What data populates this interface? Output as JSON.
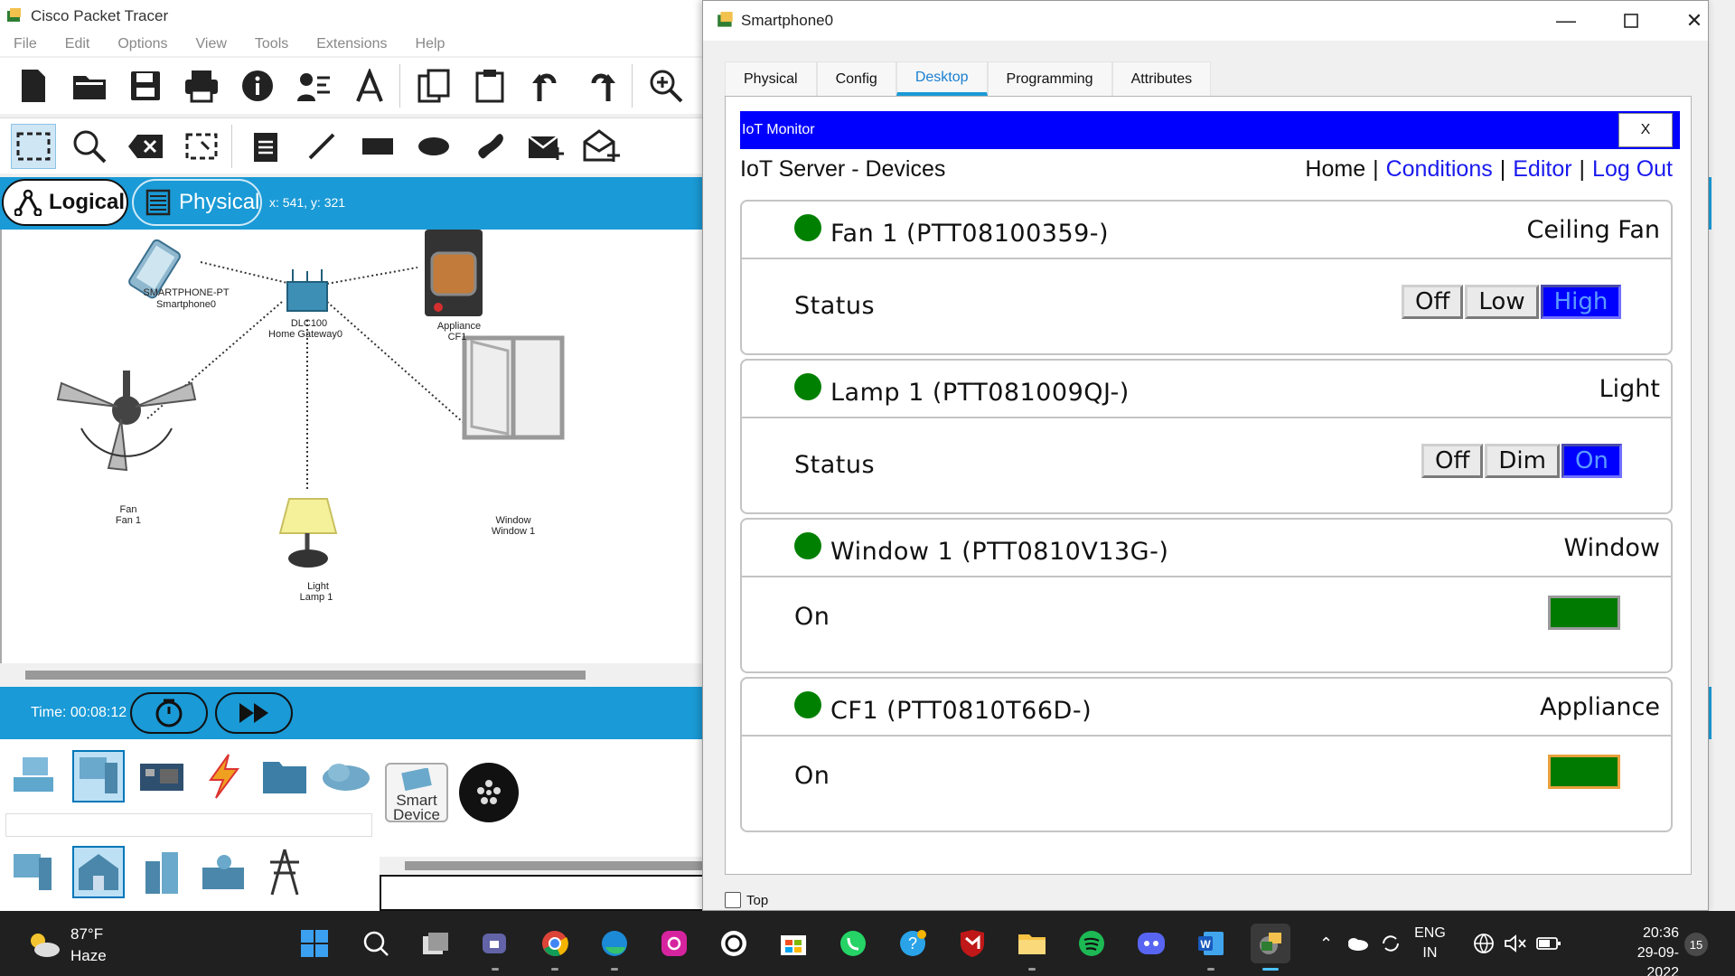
{
  "app": {
    "title": "Cisco Packet Tracer",
    "menu": [
      "File",
      "Edit",
      "Options",
      "View",
      "Tools",
      "Extensions",
      "Help"
    ]
  },
  "modes": {
    "logical": "Logical",
    "physical": "Physical",
    "coords": "x: 541, y: 321"
  },
  "workspace": {
    "devices": [
      {
        "model": "SMARTPHONE-PT",
        "name": "Smartphone0"
      },
      {
        "model": "DLC100",
        "name": "Home Gateway0"
      },
      {
        "model": "Appliance",
        "name": "CF1"
      },
      {
        "model": "Fan",
        "name": "Fan 1"
      },
      {
        "model": "Window",
        "name": "Window 1"
      },
      {
        "model": "Light",
        "name": "Lamp 1"
      }
    ]
  },
  "simulation": {
    "time": "Time: 00:08:12"
  },
  "device_panel": {
    "smart_device_label": "Smart Device"
  },
  "dialog": {
    "title": "Smartphone0",
    "tabs": [
      "Physical",
      "Config",
      "Desktop",
      "Programming",
      "Attributes"
    ],
    "active_tab": "Desktop",
    "iot": {
      "header": "IoT Monitor",
      "close": "X",
      "subtitle": "IoT Server - Devices",
      "nav": {
        "home": "Home",
        "conditions": "Conditions",
        "editor": "Editor",
        "logout": "Log Out",
        "sep": "|"
      },
      "devices": [
        {
          "name": "Fan 1 (PTT08100359-)",
          "type": "Ceiling Fan",
          "label": "Status",
          "options": [
            "Off",
            "Low",
            "High"
          ],
          "active": "High"
        },
        {
          "name": "Lamp 1 (PTT081009QJ-)",
          "type": "Light",
          "label": "Status",
          "options": [
            "Off",
            "Dim",
            "On"
          ],
          "active": "On"
        },
        {
          "name": "Window 1 (PTT0810V13G-)",
          "type": "Window",
          "label": "On"
        },
        {
          "name": "CF1 (PTT0810T66D-)",
          "type": "Appliance",
          "label": "On"
        }
      ],
      "status_color": "#008000",
      "accent": "#0000ff"
    },
    "top_checkbox": "Top"
  },
  "taskbar": {
    "weather_temp": "87°F",
    "weather_desc": "Haze",
    "lang_1": "ENG",
    "lang_2": "IN",
    "time": "20:36",
    "date": "29-09-2022",
    "notifications": "15"
  }
}
